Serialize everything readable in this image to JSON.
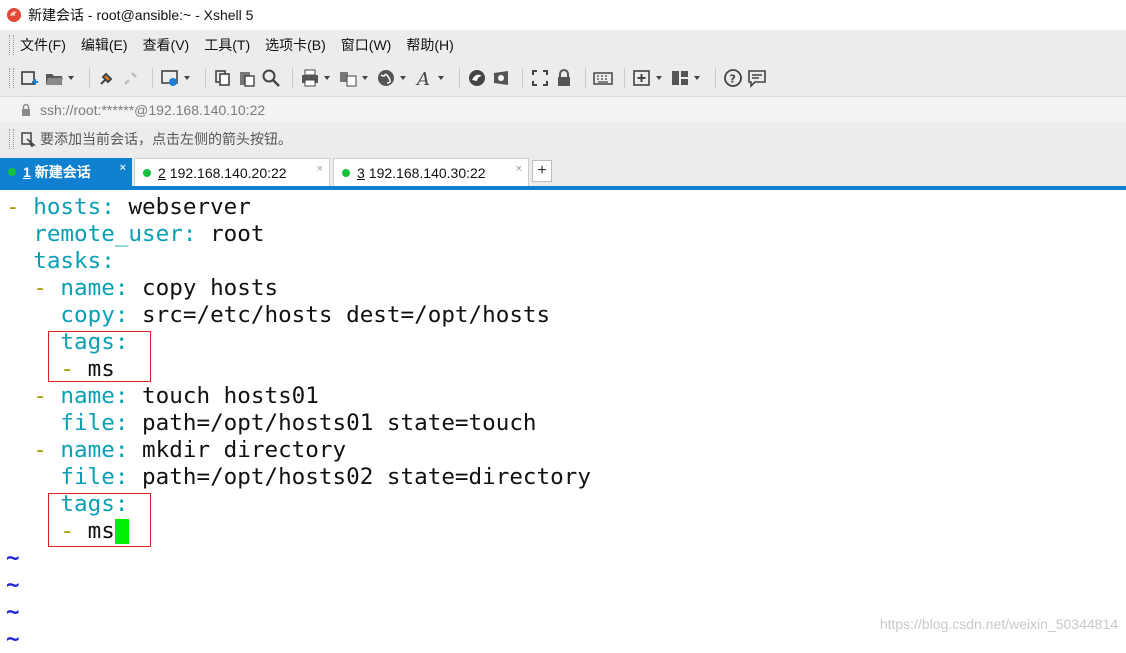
{
  "window": {
    "title": "新建会话 - root@ansible:~ - Xshell 5",
    "app_icon": "xshell-shell-icon"
  },
  "menu": {
    "items": [
      {
        "label": "文件(F)"
      },
      {
        "label": "编辑(E)"
      },
      {
        "label": "查看(V)"
      },
      {
        "label": "工具(T)"
      },
      {
        "label": "选项卡(B)"
      },
      {
        "label": "窗口(W)"
      },
      {
        "label": "帮助(H)"
      }
    ]
  },
  "toolbar": {
    "icons": [
      "new-session-icon",
      "open-folder-icon",
      "connect-icon",
      "disconnect-icon",
      "properties-icon",
      "copy-icon",
      "paste-icon",
      "find-icon",
      "print-icon",
      "transfer-icon",
      "globe-icon",
      "font-icon",
      "xftp-icon",
      "xmanager-icon",
      "fullscreen-icon",
      "lock-icon",
      "keyboard-icon",
      "new-tab-icon",
      "layout-icon",
      "help-icon",
      "chat-icon"
    ]
  },
  "address": {
    "text": "ssh://root:******@192.168.140.10:22"
  },
  "hint": {
    "text": "要添加当前会话，点击左侧的箭头按钮。"
  },
  "tabs": [
    {
      "num": "1",
      "label": "新建会话",
      "active": true
    },
    {
      "num": "2",
      "label": "192.168.140.20:22",
      "active": false
    },
    {
      "num": "3",
      "label": "192.168.140.30:22",
      "active": false
    }
  ],
  "tab_add_label": "+",
  "tab_close_label": "×",
  "terminal": {
    "lines": [
      {
        "prefix": "- ",
        "key": "hosts",
        "value": " webserver"
      },
      {
        "prefix": "  ",
        "key": "remote_user",
        "value": " root"
      },
      {
        "prefix": "  ",
        "key": "tasks",
        "value": ""
      },
      {
        "prefix": "  - ",
        "key": "name",
        "value": " copy hosts"
      },
      {
        "prefix": "    ",
        "key": "copy",
        "value": " src=/etc/hosts dest=/opt/hosts"
      },
      {
        "prefix": "    ",
        "key": "tags",
        "value": ""
      },
      {
        "prefix": "    - ",
        "key": "",
        "value": "ms"
      },
      {
        "prefix": "  - ",
        "key": "name",
        "value": " touch hosts01"
      },
      {
        "prefix": "    ",
        "key": "file",
        "value": " path=/opt/hosts01 state=touch"
      },
      {
        "prefix": "  - ",
        "key": "name",
        "value": " mkdir directory"
      },
      {
        "prefix": "    ",
        "key": "file",
        "value": " path=/opt/hosts02 state=directory"
      },
      {
        "prefix": "    ",
        "key": "tags",
        "value": ""
      },
      {
        "prefix": "    - ",
        "key": "",
        "value": "ms"
      }
    ],
    "tilde_lines": [
      "~",
      "~",
      "~",
      "~"
    ]
  },
  "watermark": "https://blog.csdn.net/weixin_50344814",
  "colors": {
    "accent": "#0f7fd0",
    "yaml_key": "#0a9fb5",
    "yaml_dash": "#a7a000",
    "cursor": "#00ee00",
    "highlight_box": "#e02020",
    "tilde": "#2525d6"
  }
}
